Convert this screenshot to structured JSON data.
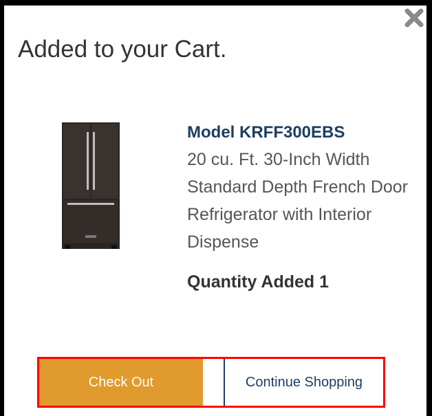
{
  "modal": {
    "title": "Added to your Cart."
  },
  "product": {
    "model": "Model KRFF300EBS",
    "description": "20 cu. Ft. 30-Inch Width Standard Depth French Door Refrigerator with Interior Dispense",
    "quantity_label": "Quantity Added 1",
    "image_icon": "refrigerator-image"
  },
  "actions": {
    "checkout_label": "Check Out",
    "continue_label": "Continue Shopping"
  },
  "colors": {
    "checkout_bg": "#e09a2e",
    "highlight_border": "#ff0000",
    "model_text": "#1c3e63"
  }
}
